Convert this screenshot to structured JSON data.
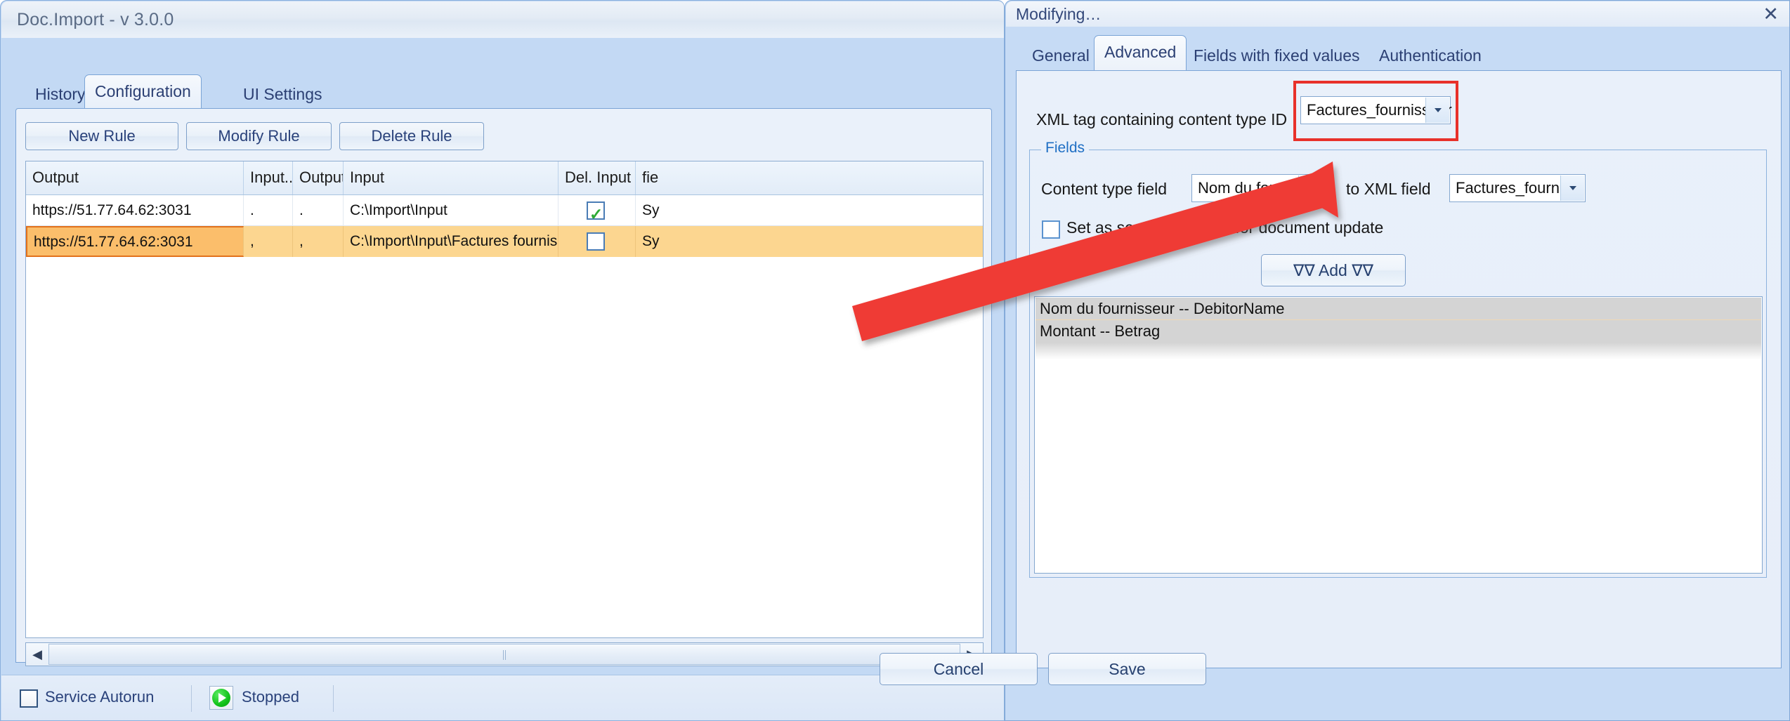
{
  "main_window": {
    "title": "Doc.Import - v 3.0.0",
    "tabs": [
      {
        "label": "History",
        "active": false
      },
      {
        "label": "Configuration",
        "active": true
      },
      {
        "label": "UI Settings",
        "active": false
      }
    ],
    "buttons": {
      "new_rule": "New Rule",
      "modify_rule": "Modify Rule",
      "delete_rule": "Delete Rule"
    },
    "grid": {
      "columns": [
        "Output",
        "Input...",
        "Output...",
        "Input",
        "Del. Input",
        "fie"
      ],
      "rows": [
        {
          "output": "https://51.77.64.62:3031",
          "input_sep": ".",
          "output_sep": ".",
          "input": "C:\\Import\\Input",
          "del_input": true,
          "fie": "Sy",
          "selected": false
        },
        {
          "output": "https://51.77.64.62:3031",
          "input_sep": ",",
          "output_sep": ",",
          "input": "C:\\Import\\Input\\Factures fournisse",
          "del_input": false,
          "fie": "Sy",
          "selected": true
        }
      ]
    },
    "scrollbar": {
      "left_arrow": "◀",
      "right_arrow": "▶"
    },
    "statusbar": {
      "autorun_label": "Service Autorun",
      "autorun_checked": false,
      "service_icon": "play-icon",
      "status_label": "Stopped"
    }
  },
  "dialog": {
    "title": "Modifying…",
    "close_label": "✕",
    "tabs": [
      {
        "label": "General",
        "active": false
      },
      {
        "label": "Advanced",
        "active": true
      },
      {
        "label": "Fields with fixed values",
        "active": false
      },
      {
        "label": "Authentication",
        "active": false
      }
    ],
    "advanced": {
      "xml_tag_label": "XML tag containing content type ID",
      "xml_tag_value": "Factures_fournisseur",
      "highlight_color": "#e8312a",
      "fields_group": {
        "title": "Fields",
        "content_type_field_label": "Content type field",
        "content_type_field_value": "Nom du fourniss",
        "to_xml_field_label": "to XML field",
        "to_xml_field_value": "Factures_fourniss",
        "search_identifier_label": "Set as search identifier for document update",
        "search_identifier_checked": false,
        "add_button": "∇∇ Add ∇∇",
        "mapping_list": [
          "Nom du fournisseur -- DebitorName",
          "Montant -- Betrag"
        ]
      }
    },
    "footer": {
      "cancel": "Cancel",
      "save": "Save"
    }
  },
  "annotation": {
    "arrow_color": "#ef3b35",
    "arrow_description": "red arrow pointing from grid row to XML tag combo"
  }
}
